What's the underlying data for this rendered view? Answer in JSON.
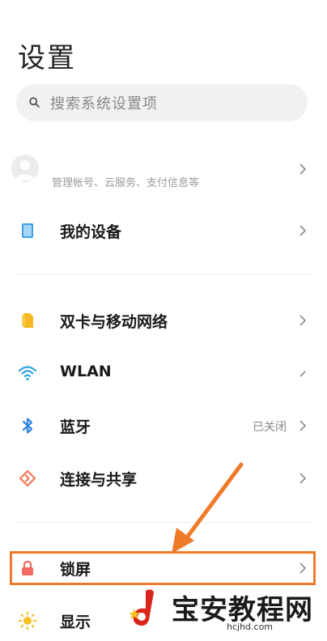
{
  "header": {
    "title": "设置"
  },
  "search": {
    "placeholder": "搜索系统设置项"
  },
  "account": {
    "subtitle": "管理帐号、云服务、支付信息等"
  },
  "items": [
    {
      "id": "my-device",
      "label": "我的设备",
      "value": ""
    },
    {
      "id": "dual-sim",
      "label": "双卡与移动网络",
      "value": ""
    },
    {
      "id": "wlan",
      "label": "WLAN",
      "value": ""
    },
    {
      "id": "bluetooth",
      "label": "蓝牙",
      "value": "已关闭"
    },
    {
      "id": "connection-sharing",
      "label": "连接与共享",
      "value": ""
    },
    {
      "id": "lock-screen",
      "label": "锁屏",
      "value": ""
    },
    {
      "id": "display",
      "label": "显示",
      "value": ""
    }
  ],
  "watermark": {
    "text": "宝安教程网",
    "domain": "hcjhd.com"
  },
  "colors": {
    "accent_orange": "#ef7a2a",
    "device_blue": "#3aa0e6",
    "sim_yellow": "#f5b820",
    "wlan_blue": "#2fa4e7",
    "bluetooth_blue": "#2f86e0",
    "connect_orange": "#f07a55",
    "lock_red": "#f26a62",
    "display_yellow": "#f5c022"
  },
  "icons": {
    "search": "search-icon",
    "avatar": "avatar",
    "my_device": "phone-icon",
    "dual_sim": "sim-card-icon",
    "wlan": "wifi-icon",
    "bluetooth": "bluetooth-icon",
    "connection": "connection-share-icon",
    "lock": "lock-icon",
    "display": "sun-icon",
    "chevron": "chevron-right-icon"
  }
}
